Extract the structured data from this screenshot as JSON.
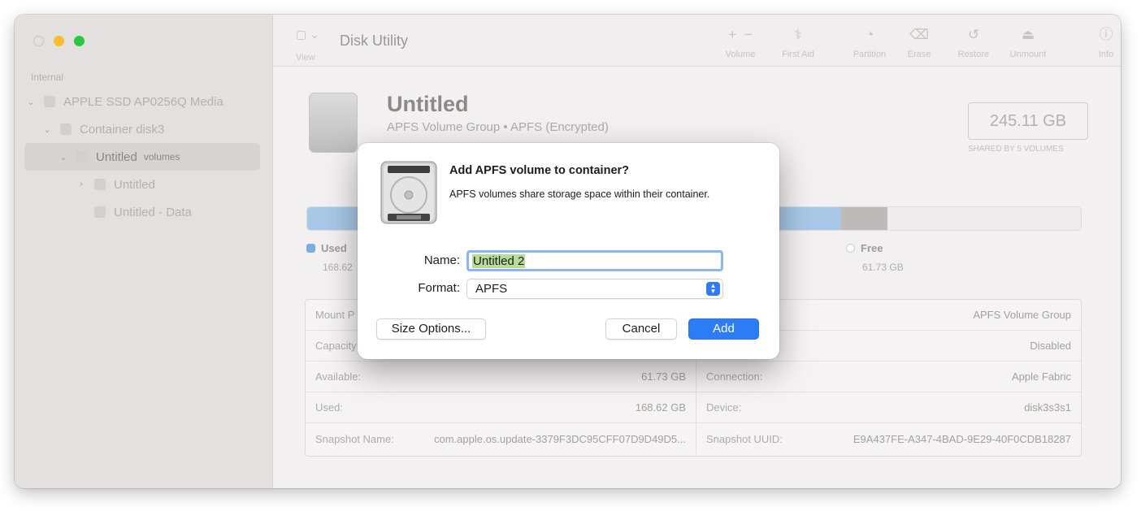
{
  "window": {
    "app_title": "Disk Utility"
  },
  "sidebar": {
    "section": "Internal",
    "items": [
      {
        "label": "APPLE SSD AP0256Q Media",
        "badge": ""
      },
      {
        "label": "Container disk3",
        "badge": ""
      },
      {
        "label": "Untitled",
        "badge": "volumes"
      },
      {
        "label": "Untitled",
        "badge": ""
      },
      {
        "label": "Untitled - Data",
        "badge": ""
      }
    ]
  },
  "toolbar": {
    "view_label": "View",
    "volume_label": "Volume",
    "first_aid_label": "First Aid",
    "partition_label": "Partition",
    "erase_label": "Erase",
    "restore_label": "Restore",
    "unmount_label": "Unmount",
    "info_label": "Info"
  },
  "volume": {
    "name": "Untitled",
    "subtitle": "APFS Volume Group • APFS (Encrypted)",
    "size": "245.11 GB",
    "size_caption": "SHARED BY 5 VOLUMES"
  },
  "usage": {
    "used_fraction": 0.69,
    "other_fraction": 0.06,
    "used_label": "Used",
    "used_value": "168.62",
    "free_label": "Free",
    "free_value": "61.73 GB"
  },
  "info": {
    "rows": [
      {
        "left_label": "Mount P",
        "left_value": "",
        "right_label": "",
        "right_value": "APFS Volume Group"
      },
      {
        "left_label": "Capacity",
        "left_value": "",
        "right_label": "",
        "right_value": "Disabled"
      },
      {
        "left_label": "Available:",
        "left_value": "61.73 GB",
        "right_label": "Connection:",
        "right_value": "Apple Fabric"
      },
      {
        "left_label": "Used:",
        "left_value": "168.62 GB",
        "right_label": "Device:",
        "right_value": "disk3s3s1"
      },
      {
        "left_label": "Snapshot Name:",
        "left_value": "com.apple.os.update-3379F3DC95CFF07D9D49D5...",
        "right_label": "Snapshot UUID:",
        "right_value": "E9A437FE-A347-4BAD-9E29-40F0CDB18287"
      }
    ]
  },
  "dialog": {
    "title": "Add APFS volume to container?",
    "message": "APFS volumes share storage space within their container.",
    "name_label": "Name:",
    "name_value": "Untitled 2",
    "format_label": "Format:",
    "format_value": "APFS",
    "size_options_label": "Size Options...",
    "cancel_label": "Cancel",
    "add_label": "Add",
    "accent": "#2c7cf6"
  }
}
